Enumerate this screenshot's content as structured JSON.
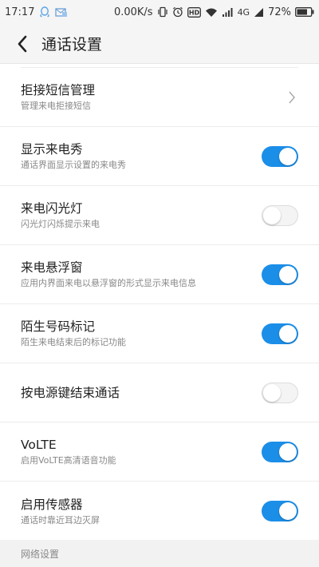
{
  "status_bar": {
    "time": "17:17",
    "net_speed": "0.00K/s",
    "hd_label": "HD",
    "network_type": "4G",
    "battery": "72%"
  },
  "header": {
    "title": "通话设置"
  },
  "rows": [
    {
      "title": "拒接短信管理",
      "subtitle": "管理来电拒接短信",
      "control": "chevron"
    },
    {
      "title": "显示来电秀",
      "subtitle": "通话界面显示设置的来电秀",
      "control": "toggle",
      "on": true
    },
    {
      "title": "来电闪光灯",
      "subtitle": "闪光灯闪烁提示来电",
      "control": "toggle",
      "on": false
    },
    {
      "title": "来电悬浮窗",
      "subtitle": "应用内界面来电以悬浮窗的形式显示来电信息",
      "control": "toggle",
      "on": true
    },
    {
      "title": "陌生号码标记",
      "subtitle": "陌生来电结束后的标记功能",
      "control": "toggle",
      "on": true
    },
    {
      "title": "按电源键结束通话",
      "subtitle": "",
      "control": "toggle",
      "on": false
    },
    {
      "title": "VoLTE",
      "subtitle": "启用VoLTE高清语音功能",
      "control": "toggle",
      "on": true
    },
    {
      "title": "启用传感器",
      "subtitle": "通话时靠近耳边灭屏",
      "control": "toggle",
      "on": true
    }
  ],
  "section": {
    "label": "网络设置"
  },
  "colors": {
    "toggle_on": "#1b8ee8",
    "toggle_off": "#f4f4f4"
  }
}
